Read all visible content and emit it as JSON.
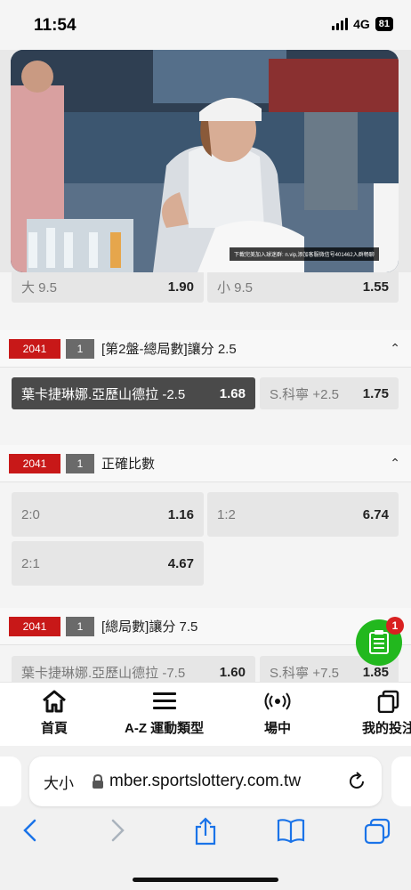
{
  "status": {
    "time": "11:54",
    "network": "4G",
    "battery": "81"
  },
  "video": {
    "caption": "下載完美加入球迷群: n.vip,添加客服微信号401462入群畅聊"
  },
  "markets": [
    {
      "code": "",
      "num": "",
      "title": "",
      "odds": [
        {
          "label": "大 9.5",
          "value": "1.90"
        },
        {
          "label": "小 9.5",
          "value": "1.55"
        }
      ]
    },
    {
      "code": "2041",
      "num": "1",
      "title": "[第2盤-總局數]讓分 2.5",
      "odds": [
        {
          "label": "葉卡捷琳娜.亞歷山德拉 -2.5",
          "value": "1.68"
        },
        {
          "label": "S.科寧 +2.5",
          "value": "1.75"
        }
      ]
    },
    {
      "code": "2041",
      "num": "1",
      "title": "正確比數",
      "odds": [
        {
          "label": "2:0",
          "value": "1.16"
        },
        {
          "label": "1:2",
          "value": "6.74"
        },
        {
          "label": "2:1",
          "value": "4.67"
        }
      ]
    },
    {
      "code": "2041",
      "num": "1",
      "title": "[總局數]讓分 7.5",
      "odds": [
        {
          "label": "葉卡捷琳娜.亞歷山德拉 -7.5",
          "value": "1.60"
        },
        {
          "label": "S.科寧 +7.5",
          "value": "1.85"
        }
      ]
    }
  ],
  "fab": {
    "badge": "1",
    "icon": "betslip-icon"
  },
  "bottom_nav": [
    {
      "label": "首頁",
      "icon": "home-icon"
    },
    {
      "label": "A-Z 運動類型",
      "icon": "menu-icon"
    },
    {
      "label": "場中",
      "icon": "live-icon"
    },
    {
      "label": "我的投注",
      "icon": "bets-icon"
    }
  ],
  "browser": {
    "aa": "大小",
    "url": "mber.sportslottery.com.tw"
  },
  "colors": {
    "market_code": "#c81818",
    "selected_odd": "#4a4a4a",
    "fab": "#22b81e",
    "badge": "#d92121",
    "ios_blue": "#1a73e8"
  }
}
